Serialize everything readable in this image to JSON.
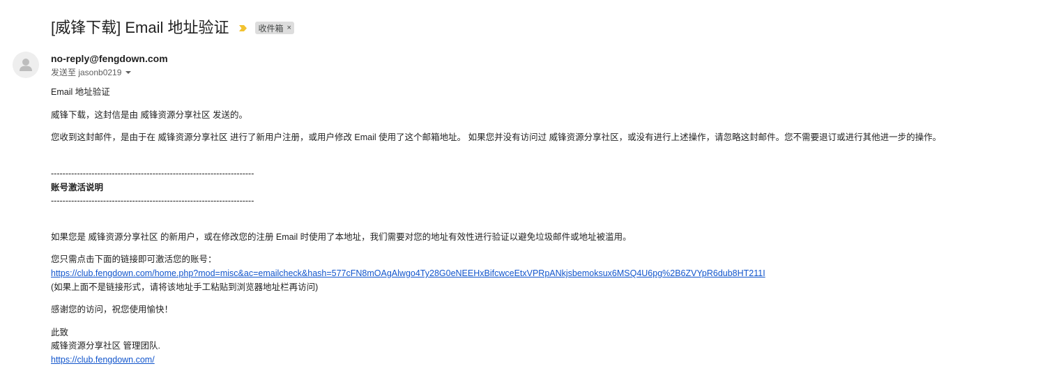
{
  "email": {
    "subject": "[威锋下载] Email 地址验证",
    "label": "收件箱",
    "label_remove": "×",
    "sender": "no-reply@fengdown.com",
    "recipient": "发送至 jasonb0219",
    "icons": {
      "importance": "importance-marker-icon",
      "avatar": "default-avatar-icon",
      "details": "chevron-down-icon"
    },
    "colors": {
      "importance": "#f2c230",
      "link": "#1155cc"
    }
  },
  "body": {
    "heading": "Email 地址验证",
    "intro": "威锋下载，这封信是由 威锋资源分享社区 发送的。",
    "reason": "您收到这封邮件，是由于在 威锋资源分享社区 进行了新用户注册，或用户修改 Email 使用了这个邮箱地址。 如果您并没有访问过 威锋资源分享社区，或没有进行上述操作，请忽略这封邮件。您不需要退订或进行其他进一步的操作。",
    "divider_top": "----------------------------------------------------------------------",
    "section_title": "账号激活说明",
    "divider_bottom": "----------------------------------------------------------------------",
    "explanation": "如果您是 威锋资源分享社区 的新用户，或在修改您的注册 Email 时使用了本地址，我们需要对您的地址有效性进行验证以避免垃圾邮件或地址被滥用。",
    "instruction": "您只需点击下面的链接即可激活您的账号：",
    "activation_link": "https://club.fengdown.com/home.php?mod=misc&ac=emailcheck&hash=577cFN8mOAgAlwgo4Ty28G0eNEEHxBifcwceEtxVPRpANkjsbemoksux6MSQ4U6pg%2B6ZVYpR6dub8HT211I",
    "fallback_note": "(如果上面不是链接形式，请将该地址手工粘贴到浏览器地址栏再访问)",
    "thanks": "感谢您的访问，祝您使用愉快！",
    "closing": "此致",
    "team": "威锋资源分享社区 管理团队.",
    "site_link": "https://club.fengdown.com/"
  }
}
